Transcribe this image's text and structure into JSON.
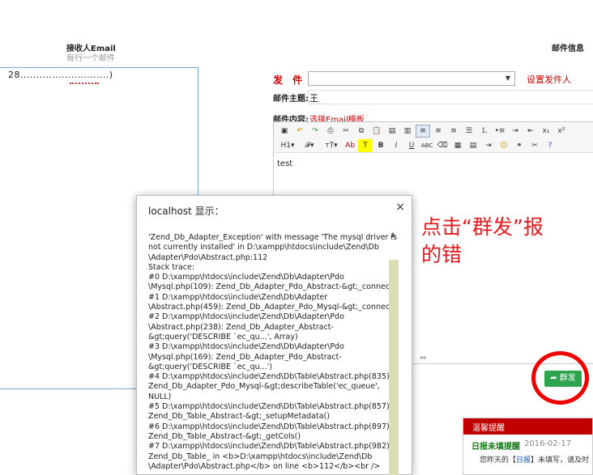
{
  "receivers": {
    "title": "接收人Email",
    "hint": "每行一个邮件",
    "value": "28‥‥‥‥‥‥‥‥‥‥‥‥‥‥)"
  },
  "mail_info": {
    "title": "邮件信息",
    "sender_label": "发 件 人:",
    "sender_value": "",
    "sender_link": "设置发件人",
    "subject_label": "邮件主题:",
    "subject_value": "王",
    "content_label": "邮件内容:",
    "template_link": "选择Email模板"
  },
  "editor": {
    "body_text": "test",
    "toolbar_row1": [
      "source-icon",
      "undo-icon",
      "redo-icon",
      "print-icon",
      "cut-icon",
      "copy-icon",
      "paste-icon",
      "paste-text-icon",
      "paste-word-icon",
      "align-left-icon",
      "align-center-icon",
      "align-right-icon",
      "justify-icon",
      "ordered-list-icon",
      "unordered-list-icon",
      "indent-icon",
      "outdent-icon",
      "subscript-icon",
      "superscript-icon"
    ],
    "toolbar_row2_labels": [
      "H1▾",
      "𝓕▾",
      "тT▾",
      "Ab",
      "T",
      "B",
      "I",
      "U",
      "ABC",
      "⌫",
      "▦",
      "▤",
      "⇥",
      "☺",
      "⚭",
      "✂",
      "?"
    ]
  },
  "send_button": {
    "label": "群发",
    "icon": "share-icon"
  },
  "annotation": "点击“群发”报的错",
  "alert": {
    "title": "localhost 显示：",
    "message_lines": [
      "'Zend_Db_Adapter_Exception' with message 'The mysql driver is",
      "not currently installed' in D:\\xampp\\htdocs\\include\\Zend\\Db",
      "\\Adapter\\Pdo\\Abstract.php:112",
      "Stack trace:",
      "#0 D:\\xampp\\htdocs\\include\\Zend\\Db\\Adapter\\Pdo",
      "\\Mysql.php(109): Zend_Db_Adapter_Pdo_Abstract-&gt;_connect()",
      "#1 D:\\xampp\\htdocs\\include\\Zend\\Db\\Adapter",
      "\\Abstract.php(459): Zend_Db_Adapter_Pdo_Mysql-&gt;_connect()",
      "#2 D:\\xampp\\htdocs\\include\\Zend\\Db\\Adapter\\Pdo",
      "\\Abstract.php(238): Zend_Db_Adapter_Abstract-",
      "&gt;query('DESCRIBE `ec_qu...', Array)",
      "#3 D:\\xampp\\htdocs\\include\\Zend\\Db\\Adapter\\Pdo",
      "\\Mysql.php(169): Zend_Db_Adapter_Pdo_Abstract-",
      "&gt;query('DESCRIBE `ec_qu...')",
      "#4 D:\\xampp\\htdocs\\include\\Zend\\Db\\Table\\Abstract.php(835):",
      "Zend_Db_Adapter_Pdo_Mysql-&gt;describeTable('ec_queue',",
      "NULL)",
      "#5 D:\\xampp\\htdocs\\include\\Zend\\Db\\Table\\Abstract.php(857):",
      "Zend_Db_Table_Abstract-&gt;_setupMetadata()",
      "#6 D:\\xampp\\htdocs\\include\\Zend\\Db\\Table\\Abstract.php(897):",
      "Zend_Db_Table_Abstract-&gt;_getCols()",
      "#7 D:\\xampp\\htdocs\\include\\Zend\\Db\\Table\\Abstract.php(982):",
      "Zend_Db_Table_ in <b>D:\\xampp\\htdocs\\include\\Zend\\Db",
      "\\Adapter\\Pdo\\Abstract.php</b> on line <b>112</b><br />"
    ]
  },
  "notice": {
    "title": "温馨提醒",
    "subtitle": "日报未填提醒",
    "date": "2016-02-17",
    "body_prefix": "您昨天的【",
    "body_link": "日报",
    "body_suffix": "】未填写，请及时"
  },
  "colors": {
    "accent_red": "#d00000",
    "send_green": "#2ea44f",
    "annotation_red": "#e8191c",
    "notice_head": "#c00000"
  }
}
